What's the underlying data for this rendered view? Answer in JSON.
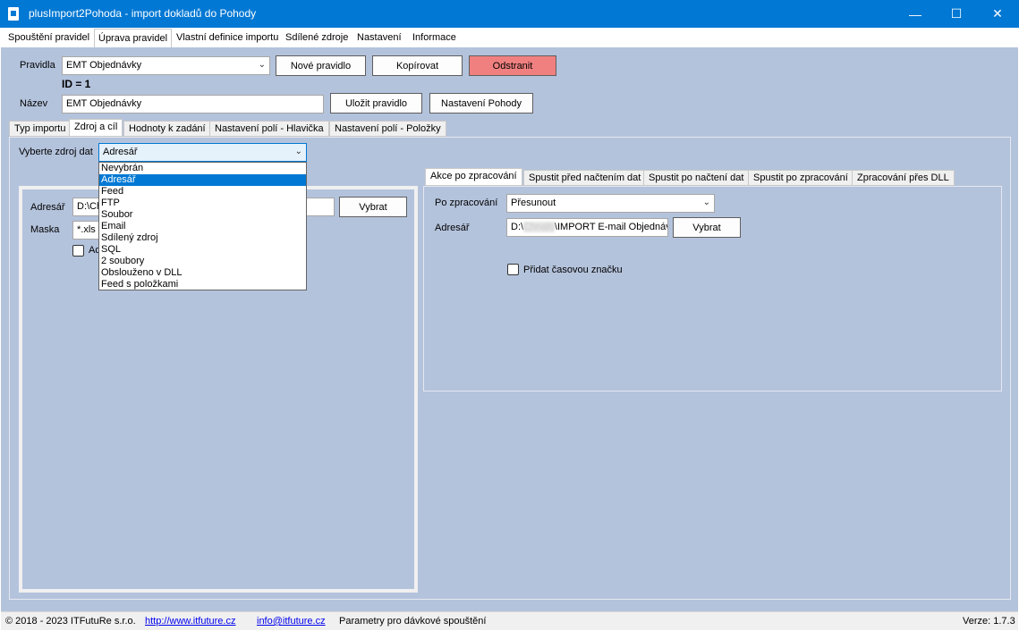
{
  "window": {
    "title": "plusImport2Pohoda - import dokladů do Pohody",
    "minimize_glyph": "—",
    "maximize_glyph": "☐",
    "close_glyph": "✕"
  },
  "menu": {
    "items": [
      "Spouštění pravidel",
      "Úprava pravidel",
      "Vlastní definice importu",
      "Sdílené zdroje",
      "Nastavení",
      "Informace"
    ],
    "active": "Úprava pravidel"
  },
  "rule": {
    "label": "Pravidla",
    "selected": "EMT Objednávky",
    "id_text": "ID = 1",
    "name_label": "Název",
    "name_value": "EMT Objednávky"
  },
  "buttons": {
    "new_rule": "Nové pravidlo",
    "copy": "Kopírovat",
    "remove": "Odstranit",
    "save_rule": "Uložit pravidlo",
    "pohoda_settings": "Nastavení Pohody",
    "select": "Vybrat"
  },
  "main_tabs": [
    "Typ importu",
    "Zdroj a cíl",
    "Hodnoty k zadání",
    "Nastavení polí - Hlavička",
    "Nastavení polí - Položky"
  ],
  "source": {
    "label": "Vyberte zdroj dat",
    "selected": "Adresář",
    "options": [
      "Nevybrán",
      "Adresář",
      "Feed",
      "FTP",
      "Soubor",
      "Email",
      "Sdílený zdroj",
      "SQL",
      "2 soubory",
      "Obslouženo v DLL",
      "Feed s položkami"
    ],
    "folder_label": "Adresář",
    "folder_value": "D:\\Ch",
    "mask_label": "Maska",
    "mask_value": "*.xls",
    "checkbox_label": "Ad"
  },
  "action_tabs": [
    "Akce po zpracování",
    "Spustit před načtením dat",
    "Spustit po načtení dat",
    "Spustit po zpracování",
    "Zpracování přes DLL"
  ],
  "action": {
    "after_label": "Po zpracování",
    "after_value": "Přesunout",
    "folder_label": "Adresář",
    "folder_prefix": "D:\\",
    "folder_redacted": "Chnalo",
    "folder_suffix": "\\IMPORT E-mail Objednáv",
    "timestamp_label": "Přidat časovou značku"
  },
  "status": {
    "copyright": "© 2018 - 2023 ITFutuRe s.r.o.",
    "website": "http://www.itfuture.cz",
    "email": "info@itfuture.cz",
    "params": "Parametry pro dávkové spouštění",
    "version": "Verze: 1.7.3"
  },
  "icons": {
    "app": "app-icon",
    "chevron": "chevron-down-icon"
  },
  "colors": {
    "titlebar": "#0078d4",
    "client": "#b4c3dc",
    "remove_button": "#f08080",
    "selection": "#0078d4"
  }
}
